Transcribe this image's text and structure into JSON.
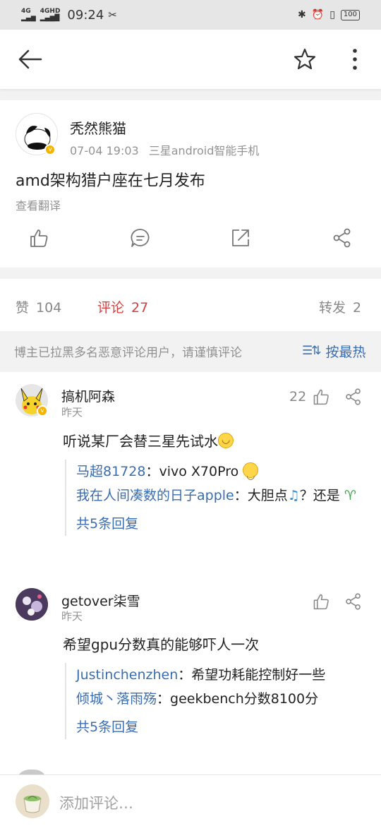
{
  "status_bar": {
    "signal_1": "4G",
    "signal_2": "4GHD",
    "time": "09:24",
    "battery": "100"
  },
  "post": {
    "author": "秃然熊猫",
    "date": "07-04 19:03",
    "device": "三星android智能手机",
    "content": "amd架构猎户座在七月发布",
    "translate_label": "查看翻译"
  },
  "stats": {
    "likes_label": "赞",
    "likes_count": "104",
    "comments_label": "评论",
    "comments_count": "27",
    "reposts_label": "转发",
    "reposts_count": "2"
  },
  "notice": {
    "text": "博主已拉黑多名恶意评论用户，请谨慎评论",
    "sort_label": "按最热"
  },
  "comments": [
    {
      "name": "搞机阿森",
      "time": "昨天",
      "text": "听说某厂会替三星先试水",
      "likes": "22",
      "replies": [
        {
          "user": "马超81728",
          "text": "：vivo X70Pro "
        },
        {
          "user": "我在人间凑数的日子apple",
          "text": "：大胆点",
          "text2": "？还是"
        }
      ],
      "more": "共5条回复"
    },
    {
      "name": "getover柒雪",
      "time": "昨天",
      "text": "希望gpu分数真的能够吓人一次",
      "replies": [
        {
          "user": "Justinchenzhen",
          "text": "：希望功耗能控制好一些"
        },
        {
          "user": "倾城丶落雨殇",
          "text": "：geekbench分数8100分"
        }
      ],
      "more": "共5条回复"
    }
  ],
  "input": {
    "placeholder": "添加评论…"
  },
  "colors": {
    "accent_blue": "#3a6db0",
    "active_red": "#d43d3d",
    "verified_badge": "#f5b400"
  }
}
